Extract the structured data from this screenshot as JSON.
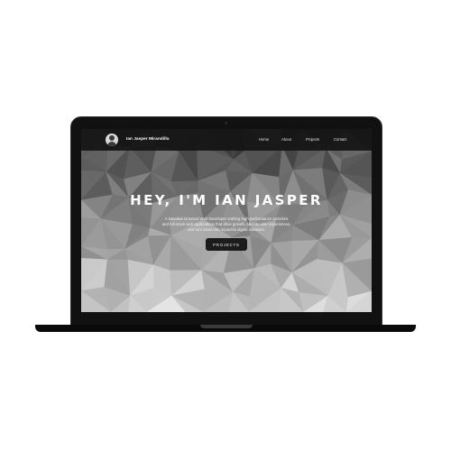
{
  "nav": {
    "brand": "Ian Jasper Mirandilla",
    "links": [
      "Home",
      "About",
      "Projects",
      "Contact"
    ]
  },
  "hero": {
    "title": "HEY, I'M IAN JASPER",
    "description_lines": [
      "A Detailed-Oriented Web Developer crafting high-performance websites",
      "and full-stack web applications that drive growth, elevate user experiences,",
      "and turn ideas into impactful digital solutions."
    ],
    "cta_label": "PROJECTS"
  },
  "colors": {
    "nav_background": "#141414",
    "button_background": "#1c1c1c",
    "laptop_body": "#111111",
    "text_primary": "#ffffff"
  },
  "icons": {
    "avatar": "profile-avatar-icon"
  }
}
